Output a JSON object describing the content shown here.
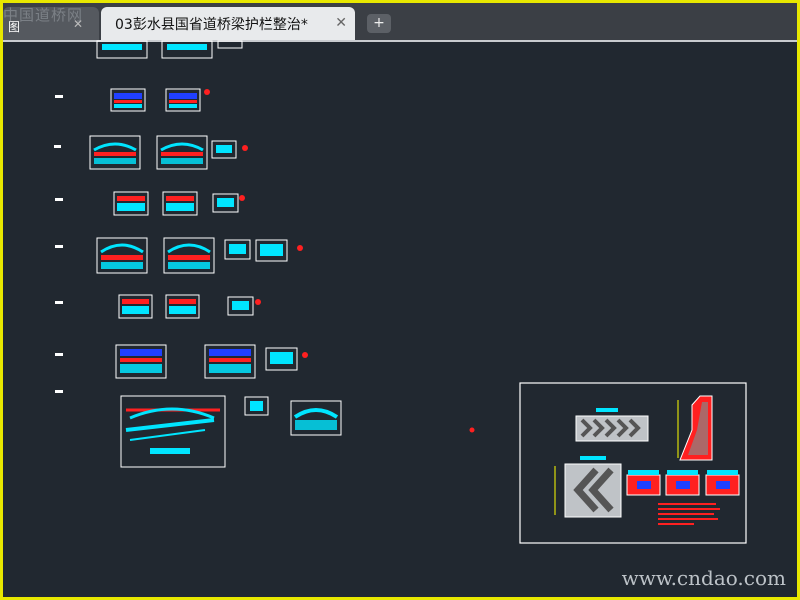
{
  "tabs": {
    "left": {
      "label": "图",
      "close": "✕"
    },
    "active": {
      "title": "03彭水县国省道桥梁护栏整治*",
      "close": "✕"
    },
    "add": "+"
  },
  "watermarks": {
    "top": "中国道桥网",
    "bottom": "www.cndao.com"
  },
  "colors": {
    "canvas": "#212830",
    "frame": "#e8e800",
    "drawing_white": "#ffffff",
    "drawing_cyan": "#00e5ff",
    "drawing_red": "#ff2020",
    "drawing_blue": "#2040ff",
    "drawing_yellow": "#ffff00",
    "drawing_magenta": "#ff00ff",
    "drawing_green": "#00ff40"
  }
}
